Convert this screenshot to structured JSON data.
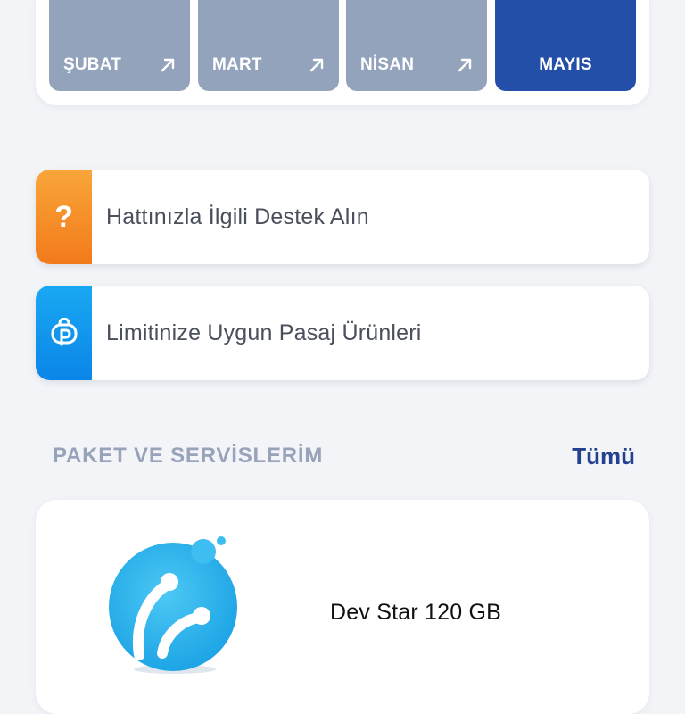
{
  "months": [
    {
      "label": "ŞUBAT",
      "active": false,
      "icon": "arrow-up-right-icon"
    },
    {
      "label": "MART",
      "active": false,
      "icon": "arrow-up-right-icon"
    },
    {
      "label": "NİSAN",
      "active": false,
      "icon": "arrow-up-right-icon"
    },
    {
      "label": "MAYIS",
      "active": true
    }
  ],
  "actions": [
    {
      "label": "Hattınızla İlgili Destek Alın",
      "icon": "question-mark-icon",
      "accent": "#f58d26"
    },
    {
      "label": "Limitinize Uygun Pasaj Ürünleri",
      "icon": "pasaj-bag-icon",
      "accent": "#1098ee"
    }
  ],
  "packages_section": {
    "title": "PAKET VE SERVİSLERİM",
    "see_all": "Tümü"
  },
  "package": {
    "name": "Dev Star 120 GB",
    "logo": "turkcell-logo-icon"
  },
  "colors": {
    "month_inactive": "#94a3bc",
    "month_active": "#244fa8",
    "link": "#24418f",
    "section_title": "#98a3ba"
  }
}
